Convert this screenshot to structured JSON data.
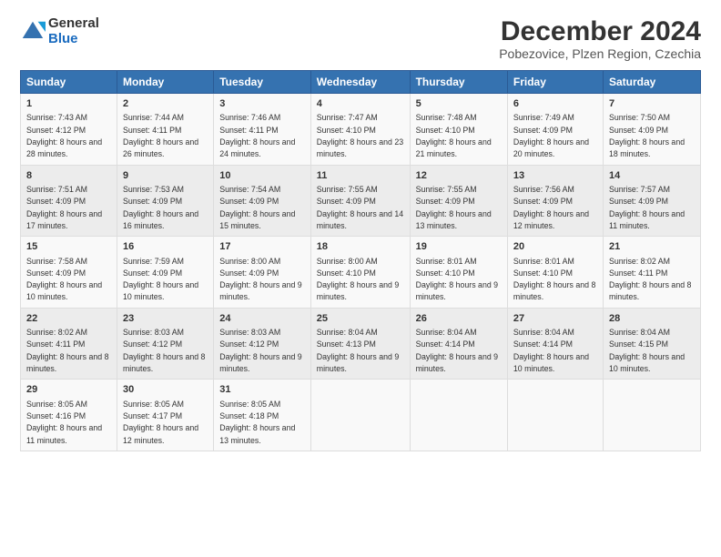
{
  "logo": {
    "general": "General",
    "blue": "Blue"
  },
  "title": "December 2024",
  "location": "Pobezovice, Plzen Region, Czechia",
  "days_of_week": [
    "Sunday",
    "Monday",
    "Tuesday",
    "Wednesday",
    "Thursday",
    "Friday",
    "Saturday"
  ],
  "weeks": [
    [
      {
        "day": "1",
        "sunrise": "7:43 AM",
        "sunset": "4:12 PM",
        "daylight": "8 hours and 28 minutes."
      },
      {
        "day": "2",
        "sunrise": "7:44 AM",
        "sunset": "4:11 PM",
        "daylight": "8 hours and 26 minutes."
      },
      {
        "day": "3",
        "sunrise": "7:46 AM",
        "sunset": "4:11 PM",
        "daylight": "8 hours and 24 minutes."
      },
      {
        "day": "4",
        "sunrise": "7:47 AM",
        "sunset": "4:10 PM",
        "daylight": "8 hours and 23 minutes."
      },
      {
        "day": "5",
        "sunrise": "7:48 AM",
        "sunset": "4:10 PM",
        "daylight": "8 hours and 21 minutes."
      },
      {
        "day": "6",
        "sunrise": "7:49 AM",
        "sunset": "4:09 PM",
        "daylight": "8 hours and 20 minutes."
      },
      {
        "day": "7",
        "sunrise": "7:50 AM",
        "sunset": "4:09 PM",
        "daylight": "8 hours and 18 minutes."
      }
    ],
    [
      {
        "day": "8",
        "sunrise": "7:51 AM",
        "sunset": "4:09 PM",
        "daylight": "8 hours and 17 minutes."
      },
      {
        "day": "9",
        "sunrise": "7:53 AM",
        "sunset": "4:09 PM",
        "daylight": "8 hours and 16 minutes."
      },
      {
        "day": "10",
        "sunrise": "7:54 AM",
        "sunset": "4:09 PM",
        "daylight": "8 hours and 15 minutes."
      },
      {
        "day": "11",
        "sunrise": "7:55 AM",
        "sunset": "4:09 PM",
        "daylight": "8 hours and 14 minutes."
      },
      {
        "day": "12",
        "sunrise": "7:55 AM",
        "sunset": "4:09 PM",
        "daylight": "8 hours and 13 minutes."
      },
      {
        "day": "13",
        "sunrise": "7:56 AM",
        "sunset": "4:09 PM",
        "daylight": "8 hours and 12 minutes."
      },
      {
        "day": "14",
        "sunrise": "7:57 AM",
        "sunset": "4:09 PM",
        "daylight": "8 hours and 11 minutes."
      }
    ],
    [
      {
        "day": "15",
        "sunrise": "7:58 AM",
        "sunset": "4:09 PM",
        "daylight": "8 hours and 10 minutes."
      },
      {
        "day": "16",
        "sunrise": "7:59 AM",
        "sunset": "4:09 PM",
        "daylight": "8 hours and 10 minutes."
      },
      {
        "day": "17",
        "sunrise": "8:00 AM",
        "sunset": "4:09 PM",
        "daylight": "8 hours and 9 minutes."
      },
      {
        "day": "18",
        "sunrise": "8:00 AM",
        "sunset": "4:10 PM",
        "daylight": "8 hours and 9 minutes."
      },
      {
        "day": "19",
        "sunrise": "8:01 AM",
        "sunset": "4:10 PM",
        "daylight": "8 hours and 9 minutes."
      },
      {
        "day": "20",
        "sunrise": "8:01 AM",
        "sunset": "4:10 PM",
        "daylight": "8 hours and 8 minutes."
      },
      {
        "day": "21",
        "sunrise": "8:02 AM",
        "sunset": "4:11 PM",
        "daylight": "8 hours and 8 minutes."
      }
    ],
    [
      {
        "day": "22",
        "sunrise": "8:02 AM",
        "sunset": "4:11 PM",
        "daylight": "8 hours and 8 minutes."
      },
      {
        "day": "23",
        "sunrise": "8:03 AM",
        "sunset": "4:12 PM",
        "daylight": "8 hours and 8 minutes."
      },
      {
        "day": "24",
        "sunrise": "8:03 AM",
        "sunset": "4:12 PM",
        "daylight": "8 hours and 9 minutes."
      },
      {
        "day": "25",
        "sunrise": "8:04 AM",
        "sunset": "4:13 PM",
        "daylight": "8 hours and 9 minutes."
      },
      {
        "day": "26",
        "sunrise": "8:04 AM",
        "sunset": "4:14 PM",
        "daylight": "8 hours and 9 minutes."
      },
      {
        "day": "27",
        "sunrise": "8:04 AM",
        "sunset": "4:14 PM",
        "daylight": "8 hours and 10 minutes."
      },
      {
        "day": "28",
        "sunrise": "8:04 AM",
        "sunset": "4:15 PM",
        "daylight": "8 hours and 10 minutes."
      }
    ],
    [
      {
        "day": "29",
        "sunrise": "8:05 AM",
        "sunset": "4:16 PM",
        "daylight": "8 hours and 11 minutes."
      },
      {
        "day": "30",
        "sunrise": "8:05 AM",
        "sunset": "4:17 PM",
        "daylight": "8 hours and 12 minutes."
      },
      {
        "day": "31",
        "sunrise": "8:05 AM",
        "sunset": "4:18 PM",
        "daylight": "8 hours and 13 minutes."
      },
      null,
      null,
      null,
      null
    ]
  ],
  "labels": {
    "sunrise": "Sunrise:",
    "sunset": "Sunset:",
    "daylight": "Daylight:"
  }
}
